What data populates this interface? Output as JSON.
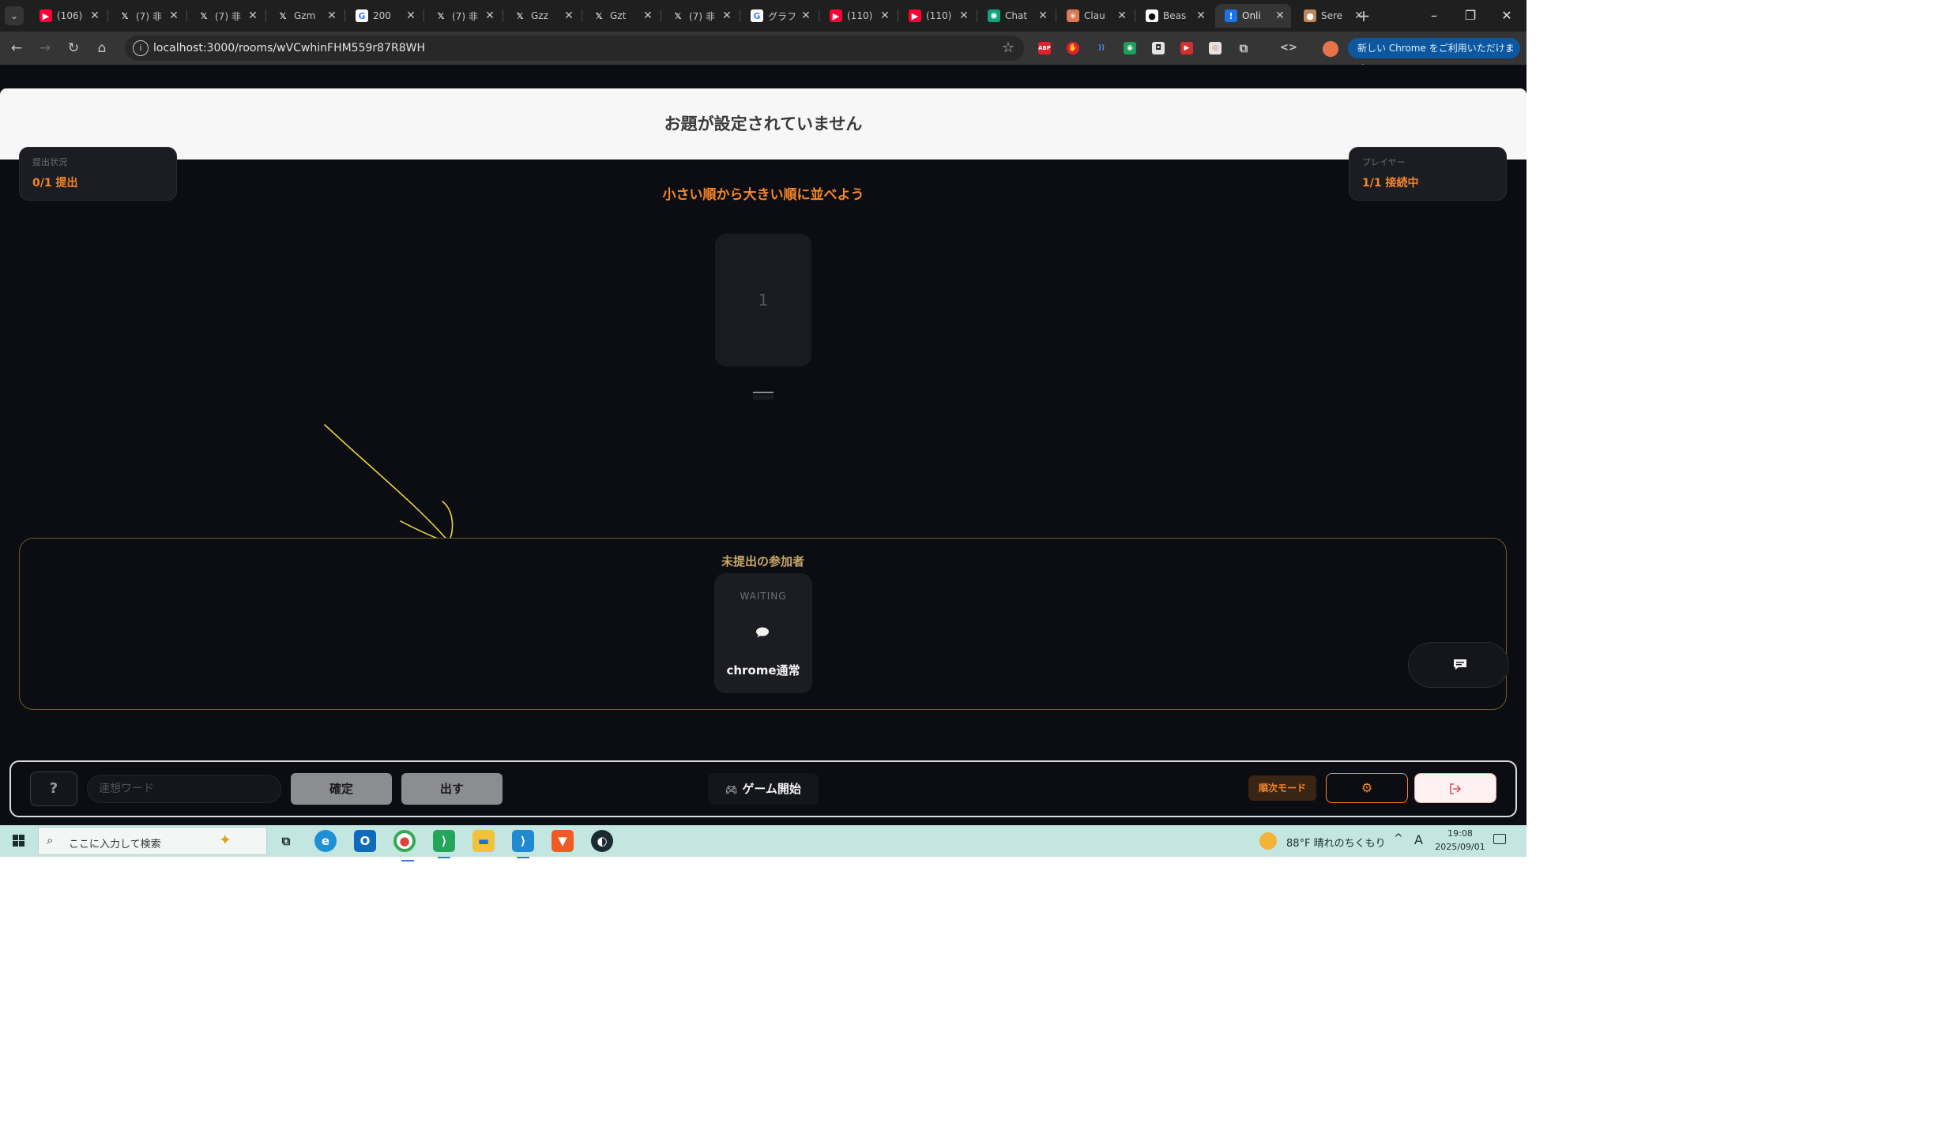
{
  "browser": {
    "tabs": [
      {
        "title": "(106)",
        "icon": "youtube-icon",
        "active": false
      },
      {
        "title": "(7) 非",
        "icon": "x-icon",
        "active": false
      },
      {
        "title": "(7) 非",
        "icon": "x-icon",
        "active": false
      },
      {
        "title": "Gzm",
        "icon": "x-icon",
        "active": false
      },
      {
        "title": "200",
        "icon": "google-icon",
        "active": false
      },
      {
        "title": "(7) 非",
        "icon": "x-icon",
        "active": false
      },
      {
        "title": "Gzz",
        "icon": "x-icon",
        "active": false
      },
      {
        "title": "Gzt",
        "icon": "x-icon",
        "active": false
      },
      {
        "title": "(7) 非",
        "icon": "x-icon",
        "active": false
      },
      {
        "title": "グラフ",
        "icon": "google-icon",
        "active": false
      },
      {
        "title": "(110)",
        "icon": "youtube-icon",
        "active": false
      },
      {
        "title": "(110)",
        "icon": "youtube-icon",
        "active": false
      },
      {
        "title": "Chat",
        "icon": "chatgpt-icon",
        "active": false
      },
      {
        "title": "Clau",
        "icon": "claude-icon",
        "active": false
      },
      {
        "title": "Beas",
        "icon": "github-icon",
        "active": false
      },
      {
        "title": "Onli",
        "icon": "app-icon",
        "active": true
      },
      {
        "title": "Sere",
        "icon": "cookie-icon",
        "active": false
      }
    ],
    "url": "localhost:3000/rooms/wVCwhinFHM559r87R8WH",
    "update_chip": "新しい Chrome をご利用いただけます"
  },
  "game": {
    "topic": "お題が設定されていません",
    "submission_status": {
      "label": "提出状況",
      "value": "0/1 提出"
    },
    "players_status": {
      "label": "プレイヤー",
      "value": "1/1 接続中"
    },
    "instruction": "小さい順から大きい順に並べよう",
    "card_slot_number": "1",
    "pending": {
      "title": "未提出の参加者",
      "players": [
        {
          "status": "WAITING",
          "name": "chrome通常"
        }
      ]
    },
    "controls": {
      "help_label": "?",
      "word_placeholder": "連想ワード",
      "confirm_label": "確定",
      "submit_label": "出す",
      "start_game_label": "ゲーム開始",
      "mode_label": "順次モード"
    }
  },
  "annotation": {
    "color": "#e9d23a"
  },
  "taskbar": {
    "search_placeholder": "ここに入力して検索",
    "weather": "88°F  晴れのちくもり",
    "ime": "A",
    "time": "19:08",
    "date": "2025/09/01"
  },
  "colors": {
    "accent": "#f5862b",
    "page_bg": "#0c0d12",
    "panel_border": "#6e5a2c",
    "leave": "#e0525c"
  }
}
